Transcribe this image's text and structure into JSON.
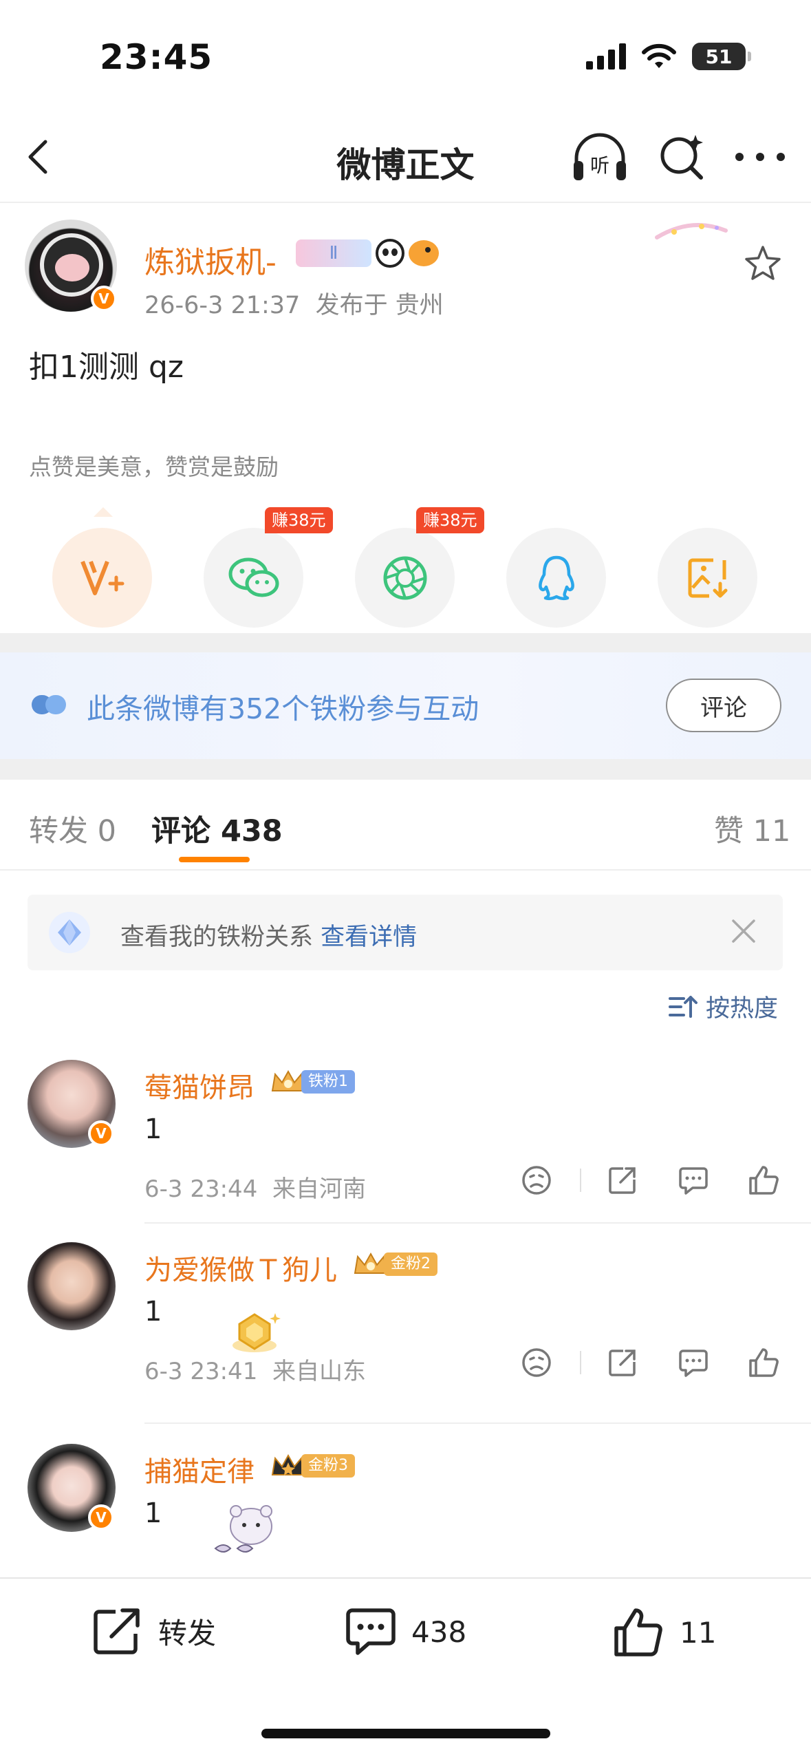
{
  "status_bar": {
    "time": "23:45",
    "battery": "51"
  },
  "nav": {
    "title": "微博正文"
  },
  "post": {
    "author": "炼狱扳机-",
    "timestamp": "26-6-3 21:37",
    "location": "发布于 贵州",
    "text": "扣1测测 qz",
    "reward_caption": "点赞是美意，赞赏是鼓励",
    "share_targets": [
      {
        "icon": "vplus-reward-icon"
      },
      {
        "icon": "wechat-icon",
        "tag": "赚38元"
      },
      {
        "icon": "moments-icon",
        "tag": "赚38元"
      },
      {
        "icon": "qq-icon"
      },
      {
        "icon": "save-image-icon"
      }
    ]
  },
  "fans_banner": {
    "text": "此条微博有352个铁粉参与互动",
    "button": "评论"
  },
  "tabs": {
    "repost": "转发 0",
    "comments": "评论 438",
    "likes": "赞 11"
  },
  "fans_relation": {
    "text": "查看我的铁粉关系",
    "link": "查看详情"
  },
  "sort": {
    "label": "按热度"
  },
  "comments": [
    {
      "name": "莓猫饼昂",
      "badge": "铁粉1",
      "badge_color": "#7ea6ec",
      "text": "1",
      "time": "6-3 23:44",
      "location": "来自河南",
      "verified": true
    },
    {
      "name": "为爱猴做Ｔ狗儿",
      "badge": "金粉2",
      "badge_color": "#f1b14b",
      "text": "1",
      "time": "6-3 23:41",
      "location": "来自山东",
      "verified": false
    },
    {
      "name": "捕猫定律",
      "badge": "金粉3",
      "badge_color": "#f1b14b",
      "text": "1",
      "time": "",
      "location": "",
      "verified": true
    }
  ],
  "bottom_bar": {
    "repost": "转发",
    "comments": "438",
    "likes": "11"
  },
  "colors": {
    "accent": "#ff8200",
    "name": "#e8761d",
    "link": "#3c6db3",
    "banner_text": "#5a8fd6"
  }
}
